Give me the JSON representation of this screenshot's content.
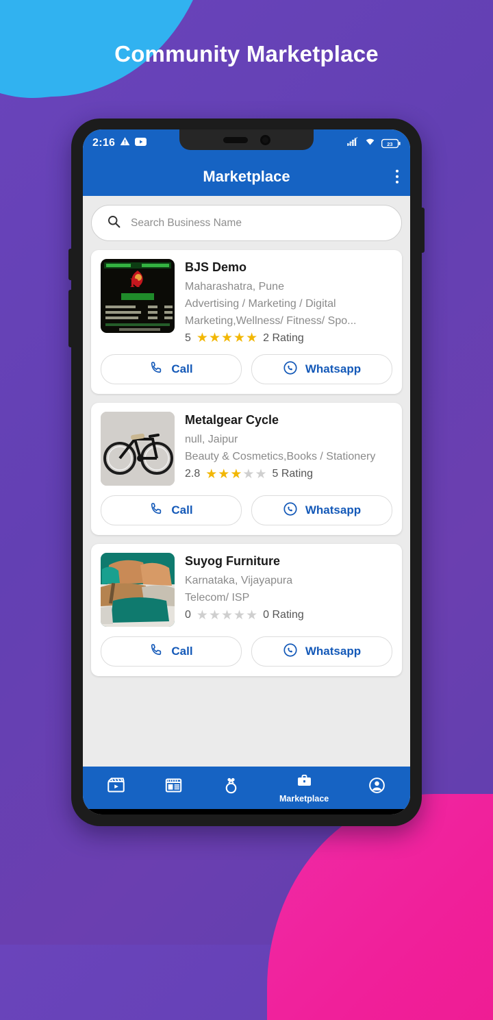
{
  "page": {
    "title": "Community Marketplace",
    "accent_purple": "#6340b3",
    "accent_cyan": "#31b2f0",
    "accent_pink": "#ef2ba6"
  },
  "status_bar": {
    "time": "2:16",
    "icons": [
      "warning-triangle-icon",
      "youtube-icon"
    ],
    "right_icons": [
      "cellular-signal-icon",
      "wifi-icon",
      "battery-icon"
    ],
    "battery_level": "23"
  },
  "app_bar": {
    "title": "Marketplace",
    "menu_icon": "kebab-menu-icon",
    "background": "#1663c3"
  },
  "search": {
    "placeholder": "Search Business Name",
    "icon": "search-icon",
    "value": ""
  },
  "listings": [
    {
      "name": "BJS Demo",
      "location": "Maharashatra, Pune",
      "categories": "Advertising / Marketing / Digital Marketing,Wellness/ Fitness/ Spo...",
      "rating_value": "5",
      "stars_filled": 5,
      "rating_count": "2 Rating",
      "thumb": "restaurant-menu-poster",
      "call_label": "Call",
      "whatsapp_label": "Whatsapp"
    },
    {
      "name": "Metalgear Cycle",
      "location": "null, Jaipur",
      "categories": "Beauty & Cosmetics,Books / Stationery",
      "rating_value": "2.8",
      "stars_filled": 3,
      "rating_count": "5 Rating",
      "thumb": "bicycle-photo",
      "call_label": "Call",
      "whatsapp_label": "Whatsapp"
    },
    {
      "name": "Suyog Furniture",
      "location": "Karnataka, Vijayapura",
      "categories": "Telecom/ ISP",
      "rating_value": "0",
      "stars_filled": 0,
      "rating_count": "0 Rating",
      "thumb": "sofa-photo",
      "call_label": "Call",
      "whatsapp_label": "Whatsapp"
    }
  ],
  "bottom_nav": {
    "items": [
      {
        "icon": "video-clapperboard-icon",
        "label": "",
        "active": false
      },
      {
        "icon": "news-layout-icon",
        "label": "",
        "active": false
      },
      {
        "icon": "ring-icon",
        "label": "",
        "active": false
      },
      {
        "icon": "briefcase-icon",
        "label": "Marketplace",
        "active": true
      },
      {
        "icon": "account-circle-icon",
        "label": "",
        "active": false
      }
    ]
  },
  "android_nav": {
    "buttons": [
      "recent-apps-square-icon",
      "home-circle-icon",
      "back-triangle-icon"
    ]
  },
  "colors": {
    "star_on": "#f2b705",
    "star_off": "#cfcfcf",
    "link_blue": "#1459b8"
  }
}
